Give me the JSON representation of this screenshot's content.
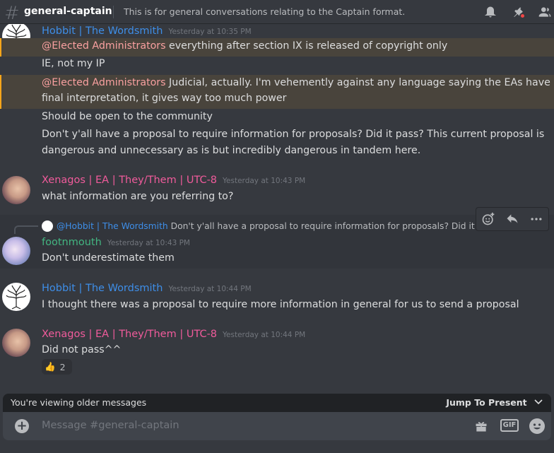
{
  "header": {
    "channel_name": "general-captain",
    "topic": "This is for general conversations relating to the Captain format."
  },
  "messages": {
    "m1": {
      "author": "Hobbit | The Wordsmith",
      "timestamp": "Yesterday at 10:35 PM",
      "line1_mention": "@Elected Administrators",
      "line1_text": " everything after section IX is released of copyright only",
      "line2": "IE, not my IP",
      "line3_mention": "@Elected Administrators",
      "line3_text": " Judicial, actually. I'm vehemently against any language saying the EAs have",
      "line4": "final interpretation, it gives way too much power",
      "line5": "Should be open to the community",
      "line6": "Don't y'all have a proposal to require information for proposals? Did it pass? This current proposal is",
      "line7": "dangerous and unnecessary as is but incredibly dangerous in tandem here."
    },
    "m2": {
      "author": "Xenagos | EA | They/Them | UTC-8",
      "timestamp": "Yesterday at 10:43 PM",
      "text": "what information are you referring to?"
    },
    "m3": {
      "reply_author": "@Hobbit | The Wordsmith",
      "reply_text": " Don't y'all have a proposal to require information for proposals? Did it pass?",
      "author": "footnmouth",
      "timestamp": "Yesterday at 10:43 PM",
      "text": "Don't underestimate them"
    },
    "m4": {
      "author": "Hobbit | The Wordsmith",
      "timestamp": "Yesterday at 10:44 PM",
      "text": "I thought there was a proposal to require more information in general for us to send a proposal"
    },
    "m5": {
      "author": "Xenagos | EA | They/Them | UTC-8",
      "timestamp": "Yesterday at 10:44 PM",
      "text": "Did not pass^^",
      "reaction_emoji": "👍",
      "reaction_count": "2"
    }
  },
  "bottom": {
    "older_text": "You're viewing older messages",
    "jump_label": "Jump To Present",
    "input_placeholder": "Message #general-captain",
    "gif_label": "GIF"
  },
  "icons": {
    "header": [
      "hash-icon",
      "bell-icon",
      "pin-icon",
      "members-icon"
    ],
    "actions": [
      "add-reaction-icon",
      "reply-icon",
      "more-icon"
    ],
    "input": [
      "plus-icon",
      "gift-icon",
      "gif-icon",
      "emoji-icon"
    ]
  },
  "colors": {
    "background": "#36393f",
    "mention_highlight": "#49443c",
    "hobbit_name": "#3e8ee8",
    "xenagos_name": "#f05b9b",
    "footnmouth_name": "#43b581"
  }
}
